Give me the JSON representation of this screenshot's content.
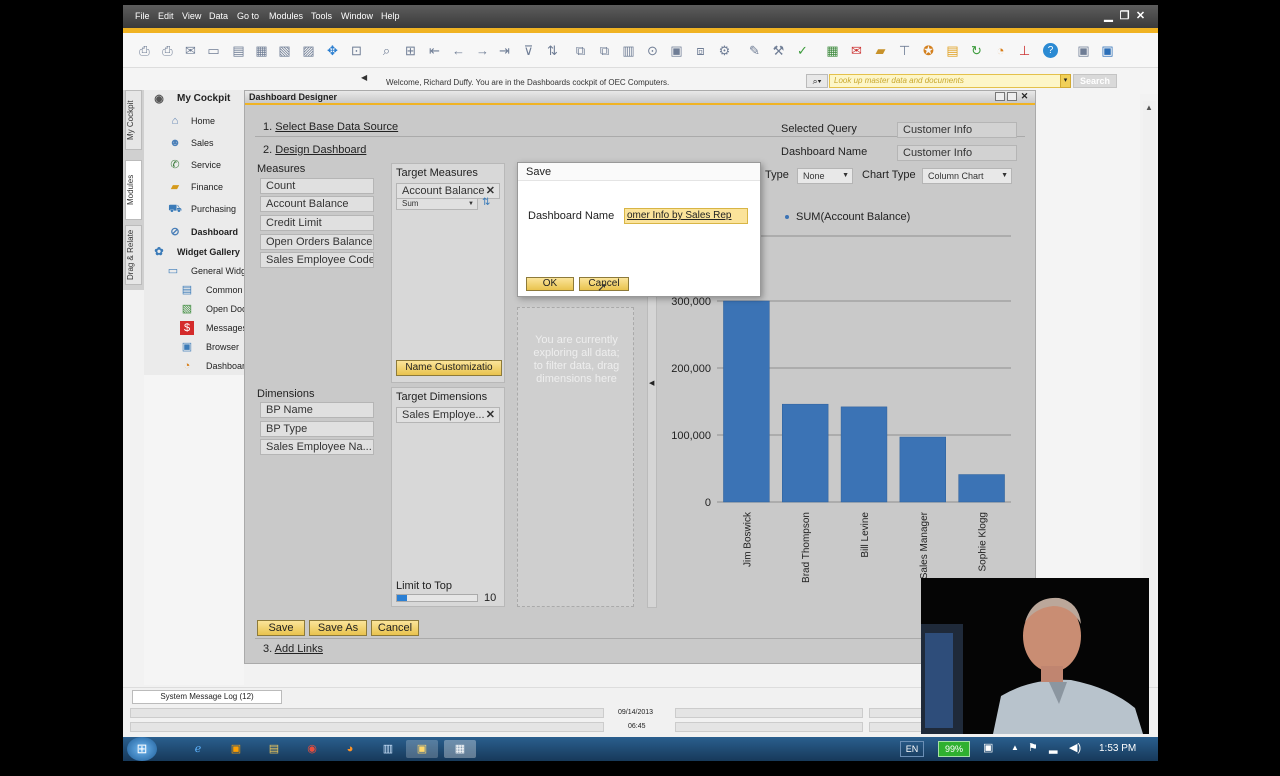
{
  "menu": [
    "File",
    "Edit",
    "View",
    "Data",
    "Go to",
    "Modules",
    "Tools",
    "Window",
    "Help"
  ],
  "welcome": "Welcome, Richard Duffy. You are in the Dashboards cockpit of OEC Computers.",
  "search": {
    "placeholder": "Look up master data and documents",
    "button": "Search"
  },
  "side_tabs": [
    "My Cockpit",
    "Modules",
    "Drag & Relate"
  ],
  "nav": {
    "cockpit": "My Cockpit",
    "items": [
      "Home",
      "Sales",
      "Service",
      "Finance",
      "Purchasing",
      "Dashboard"
    ],
    "widget_gallery": "Widget Gallery",
    "general": "General Widg",
    "widgets": [
      "Common",
      "Open Doc",
      "Messages",
      "Browser",
      "Dashboard"
    ]
  },
  "designer": {
    "title": "Dashboard Designer",
    "step1": "1.",
    "step1_link": "Select Base Data Source",
    "step2": "2.",
    "step2_link": "Design Dashboard",
    "step3": "3.",
    "step3_link": "Add Links",
    "selected_query_label": "Selected Query",
    "selected_query_value": "Customer Info",
    "dashboard_name_label": "Dashboard Name",
    "dashboard_name_value": "Customer Info",
    "type_label": "Type",
    "type_value": "None",
    "chart_type_label": "Chart Type",
    "chart_type_value": "Column Chart",
    "measures_label": "Measures",
    "measures": [
      "Count",
      "Account Balance",
      "Credit Limit",
      "Open Orders Balance",
      "Sales Employee Code"
    ],
    "target_measures_label": "Target Measures",
    "target_measure": "Account Balance",
    "aggregation": "Sum",
    "name_customization": "Name Customizatio",
    "dimensions_label": "Dimensions",
    "dimensions": [
      "BP Name",
      "BP Type",
      "Sales Employee Na..."
    ],
    "target_dimensions_label": "Target Dimensions",
    "target_dimension": "Sales Employe...",
    "limit_label": "Limit to Top",
    "limit_value": "10",
    "filter_hint": "You are currently exploring all data; to filter data, drag dimensions here",
    "save": "Save",
    "save_as": "Save As",
    "cancel": "Cancel"
  },
  "dialog": {
    "title": "Save",
    "label": "Dashboard Name",
    "value": "omer Info by Sales Rep",
    "ok": "OK",
    "cancel": "Cancel"
  },
  "chart_data": {
    "type": "bar",
    "title": "",
    "legend": "SUM(Account Balance)",
    "categories": [
      "Jim Boswick",
      "Brad Thompson",
      "Bill Levine",
      "Sales Manager",
      "Sophie Klogg"
    ],
    "values": [
      300000,
      146000,
      142000,
      97000,
      41000
    ],
    "yticks": [
      "0",
      "100,000",
      "200,000",
      "300,000"
    ],
    "ylim": [
      0,
      300000
    ],
    "bar_color": "#3b73b5",
    "grid": true
  },
  "status": {
    "message_log": "System Message Log (12)",
    "date": "09/14/2013",
    "time": "06:45"
  },
  "tray": {
    "lang": "EN",
    "battery": "99%",
    "clock": "1:53 PM"
  }
}
